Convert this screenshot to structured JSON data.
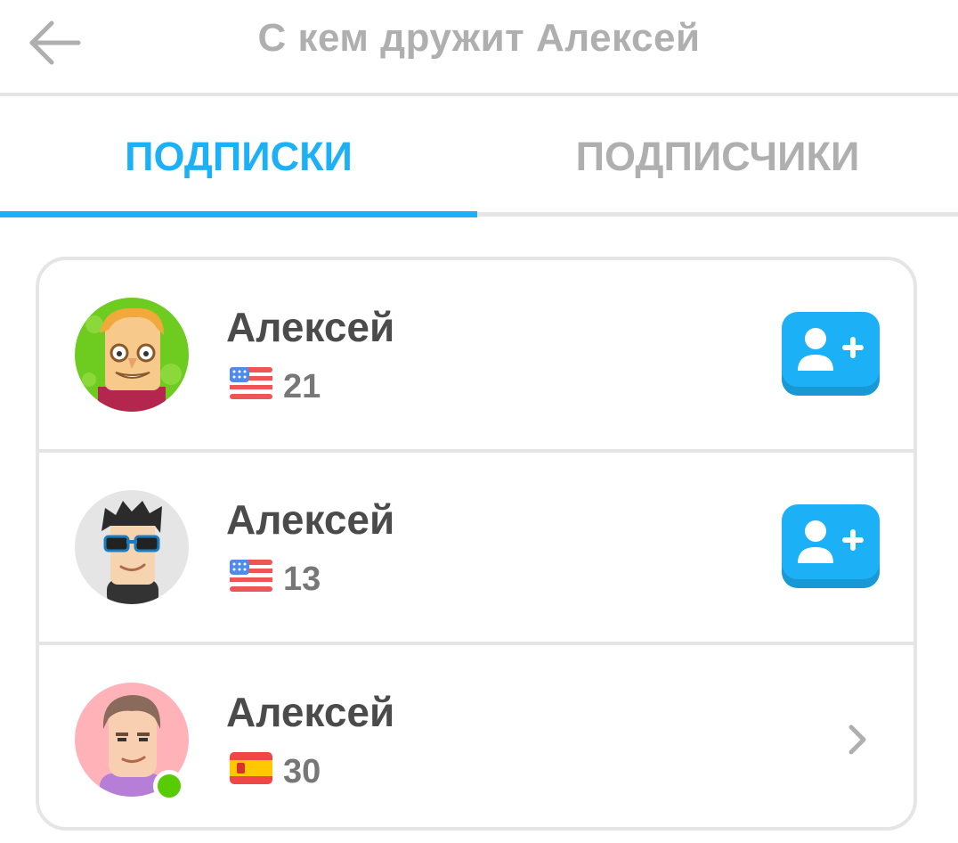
{
  "header": {
    "title": "С кем дружит Алексей",
    "back_icon": "arrow-left-icon"
  },
  "tabs": [
    {
      "label": "ПОДПИСКИ",
      "active": true
    },
    {
      "label": "ПОДПИСЧИКИ",
      "active": false
    }
  ],
  "colors": {
    "accent": "#1cb0f6",
    "inactive": "#afafaf",
    "divider": "#e5e5e5",
    "online": "#58cc02"
  },
  "users": [
    {
      "name": "Алексей",
      "xp": "21",
      "flag_icon": "us-flag-icon",
      "action": "follow-button",
      "online": false
    },
    {
      "name": "Алексей",
      "xp": "13",
      "flag_icon": "us-flag-icon",
      "action": "follow-button",
      "online": false
    },
    {
      "name": "Алексей",
      "xp": "30",
      "flag_icon": "spain-flag-icon",
      "action": "chevron-right-icon",
      "online": true
    }
  ]
}
